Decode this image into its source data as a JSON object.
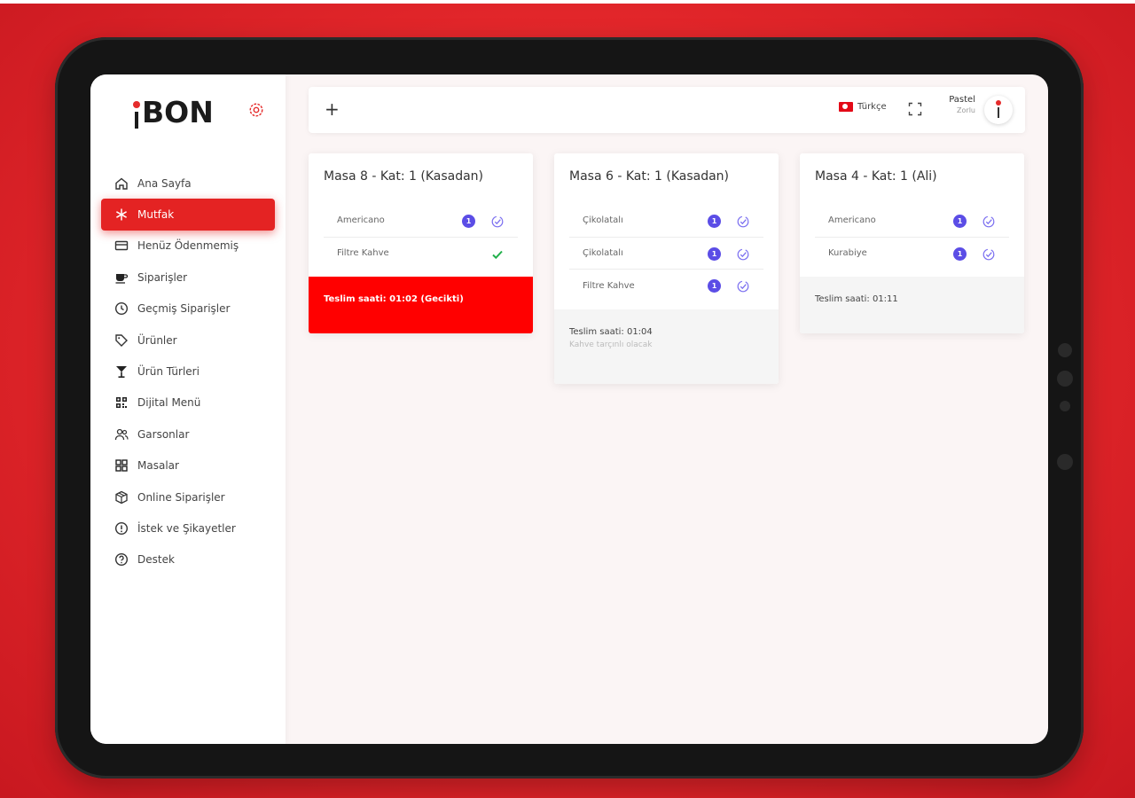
{
  "brand": {
    "logo_text": "BON"
  },
  "sidebar": {
    "items": [
      {
        "label": "Ana Sayfa",
        "icon": "home-icon"
      },
      {
        "label": "Mutfak",
        "icon": "snowflake-icon",
        "active": true
      },
      {
        "label": "Henüz Ödenmemiş",
        "icon": "credit-card-icon"
      },
      {
        "label": "Siparişler",
        "icon": "coffee-icon"
      },
      {
        "label": "Geçmiş Siparişler",
        "icon": "clock-icon"
      },
      {
        "label": "Ürünler",
        "icon": "tag-icon"
      },
      {
        "label": "Ürün Türleri",
        "icon": "cocktail-icon"
      },
      {
        "label": "Dijital Menü",
        "icon": "qr-code-icon"
      },
      {
        "label": "Garsonlar",
        "icon": "users-icon"
      },
      {
        "label": "Masalar",
        "icon": "grid-icon"
      },
      {
        "label": "Online Siparişler",
        "icon": "package-icon"
      },
      {
        "label": "İstek ve Şikayetler",
        "icon": "alert-circle-icon"
      },
      {
        "label": "Destek",
        "icon": "help-circle-icon"
      }
    ]
  },
  "header": {
    "add_label": "+",
    "language": "Türkçe",
    "user_name": "Pastel",
    "user_role": "Zorlu"
  },
  "orders": [
    {
      "title": "Masa 8 - Kat: 1 (Kasadan)",
      "items": [
        {
          "name": "Americano",
          "qty": "1",
          "status": "pending"
        },
        {
          "name": "Filtre Kahve",
          "qty": "",
          "status": "done"
        }
      ],
      "footer": "Teslim saati: 01:02 (Gecikti)",
      "footer_style": "late",
      "note": ""
    },
    {
      "title": "Masa 6 - Kat: 1 (Kasadan)",
      "items": [
        {
          "name": "Çikolatalı",
          "qty": "1",
          "status": "pending"
        },
        {
          "name": "Çikolatalı",
          "qty": "1",
          "status": "pending"
        },
        {
          "name": "Filtre Kahve",
          "qty": "1",
          "status": "pending"
        }
      ],
      "footer": "Teslim saati: 01:04",
      "footer_style": "normal",
      "note": "Kahve tarçınlı olacak"
    },
    {
      "title": "Masa 4 - Kat: 1 (Ali)",
      "items": [
        {
          "name": "Americano",
          "qty": "1",
          "status": "pending"
        },
        {
          "name": "Kurabiye",
          "qty": "1",
          "status": "pending"
        }
      ],
      "footer": "Teslim saati: 01:11",
      "footer_style": "normal",
      "note": ""
    }
  ],
  "colors": {
    "accent": "#e42323",
    "badge": "#5b4de6",
    "done": "#22b04b"
  }
}
